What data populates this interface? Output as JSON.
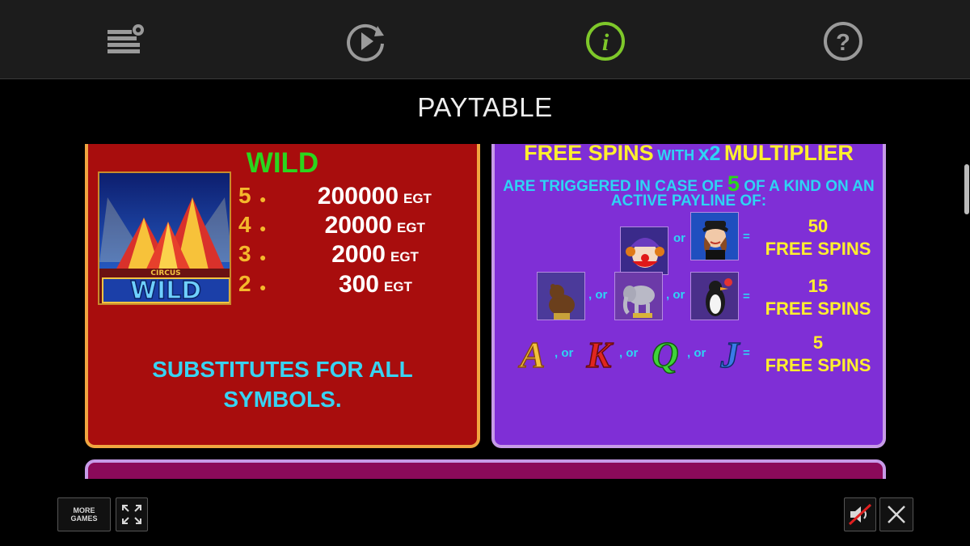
{
  "header": {
    "title": "PAYTABLE",
    "icons": [
      "settings-icon",
      "autoplay-icon",
      "info-icon",
      "help-icon"
    ],
    "accent": "#7ec82a"
  },
  "wild_panel": {
    "title": "WILD",
    "symbol_text": "WILD",
    "symbol_subtext": "CIRCUS",
    "pays": [
      {
        "count": "5",
        "value": "200000",
        "currency": "EGT"
      },
      {
        "count": "4",
        "value": "20000",
        "currency": "EGT"
      },
      {
        "count": "3",
        "value": "2000",
        "currency": "EGT"
      },
      {
        "count": "2",
        "value": "300",
        "currency": "EGT"
      }
    ],
    "description": "SUBSTITUTES FOR ALL SYMBOLS."
  },
  "free_spins_panel": {
    "head_1": "FREE SPINS",
    "head_2": "WITH",
    "head_3": "x2",
    "head_4": "MULTIPLIER",
    "line_1a": "ARE TRIGGERED IN CASE OF",
    "line_1b": "5",
    "line_1c": "OF A KIND ON AN",
    "line_2": "ACTIVE PAYLINE OF:",
    "or": "or",
    "comma_or": ", or",
    "equals": "=",
    "rows": [
      {
        "count": "50",
        "label": "FREE SPINS"
      },
      {
        "count": "15",
        "label": "FREE SPINS"
      },
      {
        "count": "5",
        "label": "FREE SPINS"
      }
    ],
    "letters": [
      "A",
      "K",
      "Q",
      "J"
    ]
  },
  "bottom": {
    "more_games_1": "MORE",
    "more_games_2": "GAMES",
    "icons": [
      "fullscreen-icon",
      "sound-muted-icon",
      "close-icon"
    ]
  }
}
